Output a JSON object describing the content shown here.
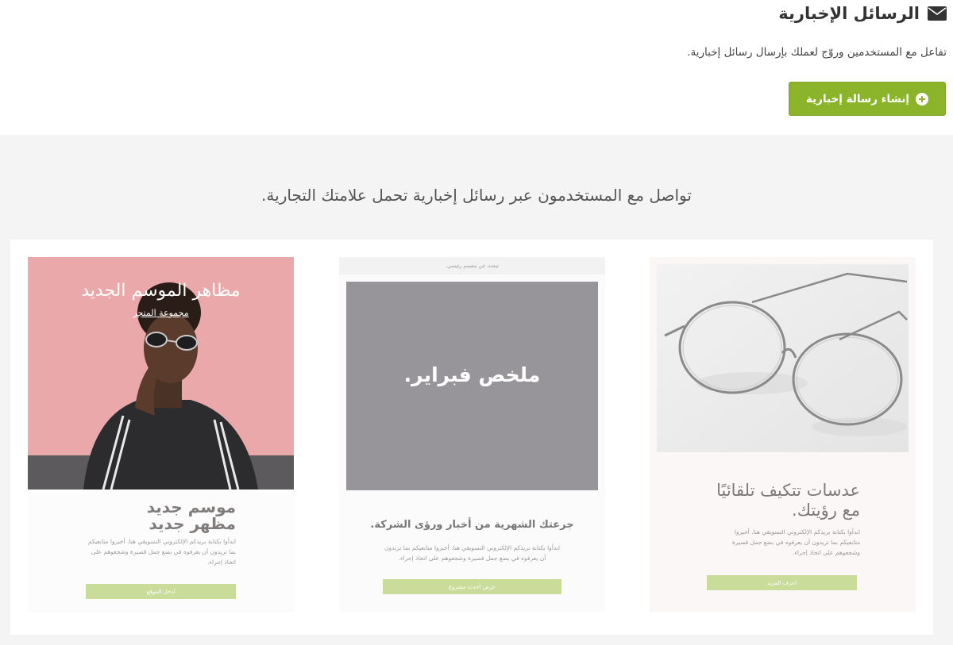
{
  "header": {
    "title": "الرسائل الإخبارية",
    "title_icon": "envelope-icon",
    "subtitle": "تفاعل مع المستخدمين وروّج لعملك بإرسال رسائل إخبارية.",
    "create_button": "إنشاء رسالة إخبارية",
    "create_button_icon": "plus-circle-icon",
    "accent_color": "#8cb42a"
  },
  "gallery": {
    "heading": "تواصل مع المستخدمون عبر رسائل إخبارية تحمل علامتك التجارية.",
    "cards": [
      {
        "title": "عدسات تتكيف تلقائيًا مع رؤيتك.",
        "body": "ابدأوا بكتابة بريدكم الإلكتروني التسويقي هنا. أخبروا متابعيكم بما تريدون أن يعرفوه في بضع جمل قصيرة وشجعوهم على اتخاذ إجراء.",
        "button": "اعرف المزيد"
      },
      {
        "top_bar": "تبحث عن مصمم رئيسي.",
        "image_text": "ملخص فبراير.",
        "title": "جرعتك الشهرية من أخبار ورؤى الشركة.",
        "body": "ابدأوا بكتابة بريدكم الإلكتروني التسويقي هنا. أخبروا متابعيكم بما تريدون أن يعرفوه في بضع جمل قصيرة وشجعوهم على اتخاذ إجراء.",
        "button": "عرض أحدث مشروع"
      },
      {
        "image_title": "مظاهر الموسم الجديد",
        "image_link": "مجموعة المتجر",
        "title": "موسم جديد مظهر جديد",
        "body": "ابدأوا بكتابة بريدكم الإلكتروني التسويقي هنا. أخبروا متابعيكم بما تريدون أن يعرفوه في بضع جمل قصيرة وشجعوهم على اتخاذ إجراء.",
        "button": "ادخل الموقع"
      }
    ]
  }
}
